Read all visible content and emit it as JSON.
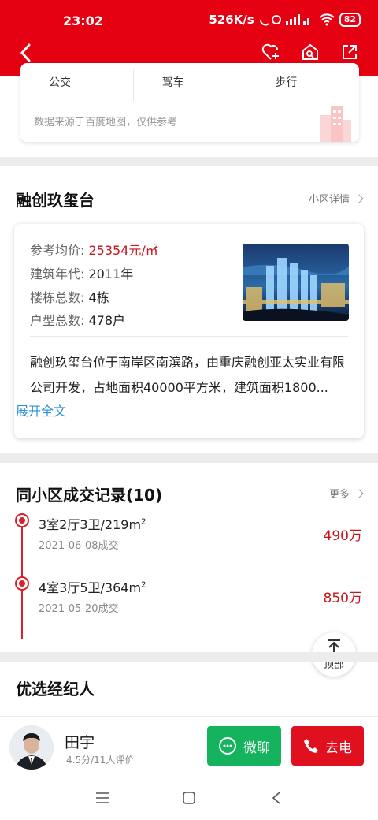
{
  "status_bar": {
    "time": "23:02",
    "network_speed": "526K/s",
    "battery": "82"
  },
  "app_bar": {
    "icons": [
      "back-icon",
      "heart-add-icon",
      "home-search-icon",
      "share-icon"
    ]
  },
  "transport": {
    "modes": [
      "公交",
      "驾车",
      "步行"
    ],
    "note": "数据来源于百度地图，仅供参考"
  },
  "community": {
    "title": "融创玖玺台",
    "detail_link": "小区详情",
    "price_label": "参考均价: ",
    "price_value": "25354元/㎡",
    "year_label": "建筑年代: ",
    "year_value": "2011年",
    "buildings_label": "楼栋总数: ",
    "buildings_value": "4栋",
    "units_label": "户型总数: ",
    "units_value": "478户",
    "description": "融创玖玺台位于南岸区南滨路，由重庆融创亚太实业有限公司开发，占地面积40000平方米，建筑面积1800...",
    "expand_label": "展开全文"
  },
  "transactions": {
    "title": "同小区成交记录(10)",
    "more_label": "更多",
    "items": [
      {
        "layout": "3室2厅3卫/219m",
        "sup": "2",
        "date": "2021-06-08成交",
        "price": "490万"
      },
      {
        "layout": "4室3厅5卫/364m",
        "sup": "2",
        "date": "2021-05-20成交",
        "price": "850万"
      }
    ]
  },
  "back_to_top": "顶部",
  "agents": {
    "title": "优选经纪人",
    "name": "田宇",
    "rating": "4.5分/11人评价",
    "wechat_label": "微聊",
    "call_label": "去电"
  },
  "colors": {
    "brand_red": "#e50012",
    "price_red": "#c4161c",
    "link_blue": "#2a8fd8",
    "wechat_green": "#16b35e"
  }
}
